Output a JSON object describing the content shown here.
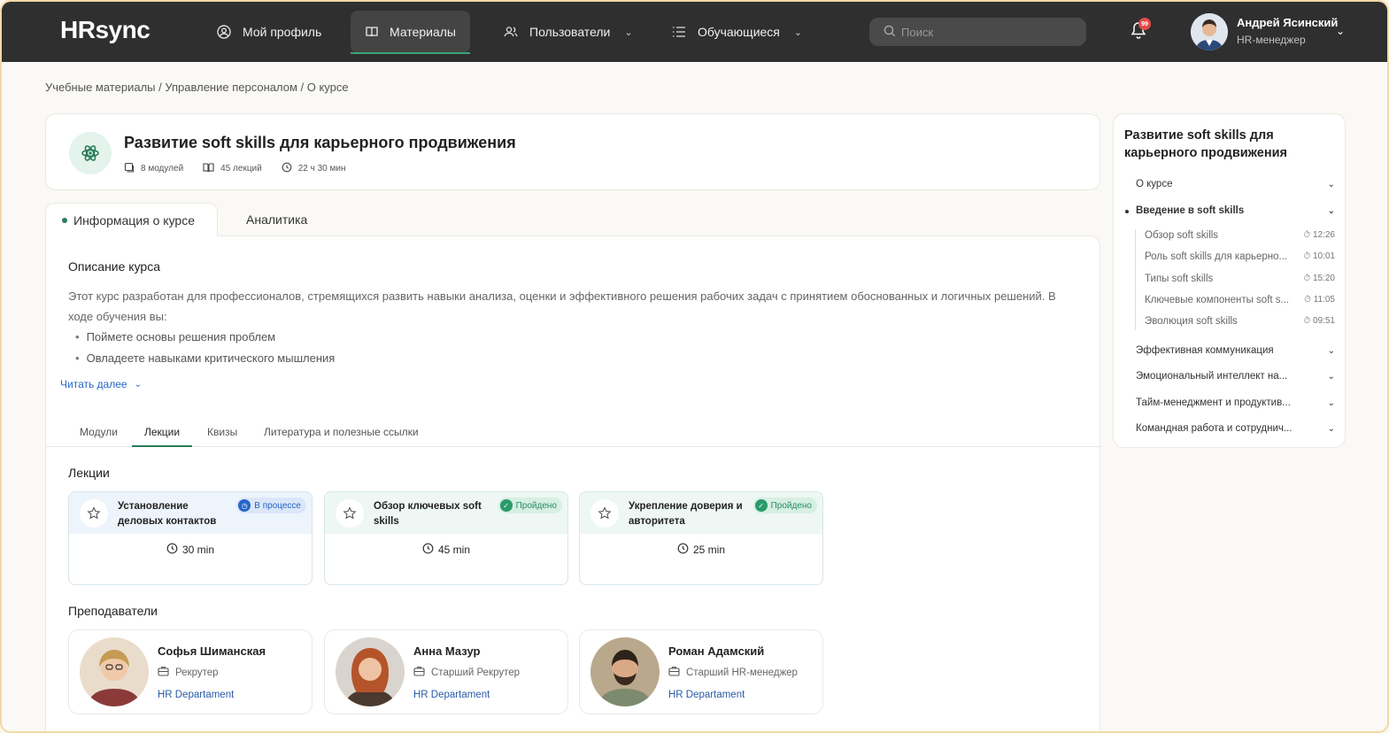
{
  "header": {
    "logo": "HRsync",
    "nav": [
      {
        "label": "Мой профиль",
        "icon": "user-circle-icon"
      },
      {
        "label": "Материалы",
        "icon": "book-icon"
      },
      {
        "label": "Пользователи",
        "icon": "users-icon"
      },
      {
        "label": "Обучающиеся",
        "icon": "list-icon"
      }
    ],
    "search_placeholder": "Поиск",
    "notifications_count": "99",
    "user": {
      "name": "Андрей Ясинский",
      "role": "HR-менеджер"
    }
  },
  "breadcrumb": "Учебные материалы / Управление персоналом / О курсе",
  "course": {
    "title": "Развитие soft skills для карьерного продвижения",
    "modules": "8 модулей",
    "lectures": "45 лекций",
    "duration": "22 ч 30 мин"
  },
  "tabs": {
    "info": "Информация о курсе",
    "analytics": "Аналитика"
  },
  "description": {
    "title": "Описание курса",
    "text": "Этот курс разработан для профессионалов, стремящихся развить навыки анализа, оценки и эффективного решения рабочих задач с принятием обоснованных и логичных решений. В ходе обучения вы:",
    "bullets": [
      "Поймете основы решения проблем",
      "Овладеете навыками критического мышления"
    ],
    "read_more": "Читать далее"
  },
  "sub_tabs": [
    "Модули",
    "Лекции",
    "Квизы",
    "Литература и полезные ссылки"
  ],
  "lectures": {
    "title": "Лекции",
    "items": [
      {
        "name": "Установление деловых контактов",
        "status": "В процессе",
        "duration": "30 min"
      },
      {
        "name": "Обзор ключевых soft skills",
        "status": "Пройдено",
        "duration": "45 min"
      },
      {
        "name": "Укрепление доверия и авторитета",
        "status": "Пройдено",
        "duration": "25 min"
      }
    ]
  },
  "teachers": {
    "title": "Преподаватели",
    "items": [
      {
        "name": "Софья Шиманская",
        "role": "Рекрутер",
        "dept": "HR Departament"
      },
      {
        "name": "Анна Мазур",
        "role": "Старший Рекрутер",
        "dept": "HR Departament"
      },
      {
        "name": "Роман Адамский",
        "role": "Старший HR-менеджер",
        "dept": "HR Departament"
      }
    ]
  },
  "toc": {
    "title": "Развитие soft skills для карьерного продвижения",
    "items": [
      {
        "label": "О курсе"
      },
      {
        "label": "Введение в soft skills"
      },
      {
        "label": "Эффективная коммуникация"
      },
      {
        "label": "Эмоциональный интеллект на..."
      },
      {
        "label": "Тайм-менеджмент и продуктив..."
      },
      {
        "label": "Командная работа и сотруднич..."
      }
    ],
    "sub_items": [
      {
        "label": "Обзор soft skills",
        "time": "12:26"
      },
      {
        "label": "Роль soft skills для карьерно...",
        "time": "10:01"
      },
      {
        "label": "Типы soft skills",
        "time": "15:20"
      },
      {
        "label": "Ключевые компоненты soft s...",
        "time": "11:05"
      },
      {
        "label": "Эволюция soft skills",
        "time": "09:51"
      }
    ]
  },
  "colors": {
    "accent": "#2a7d5a",
    "header_bg": "#2f2f2f",
    "link": "#2565c7"
  }
}
